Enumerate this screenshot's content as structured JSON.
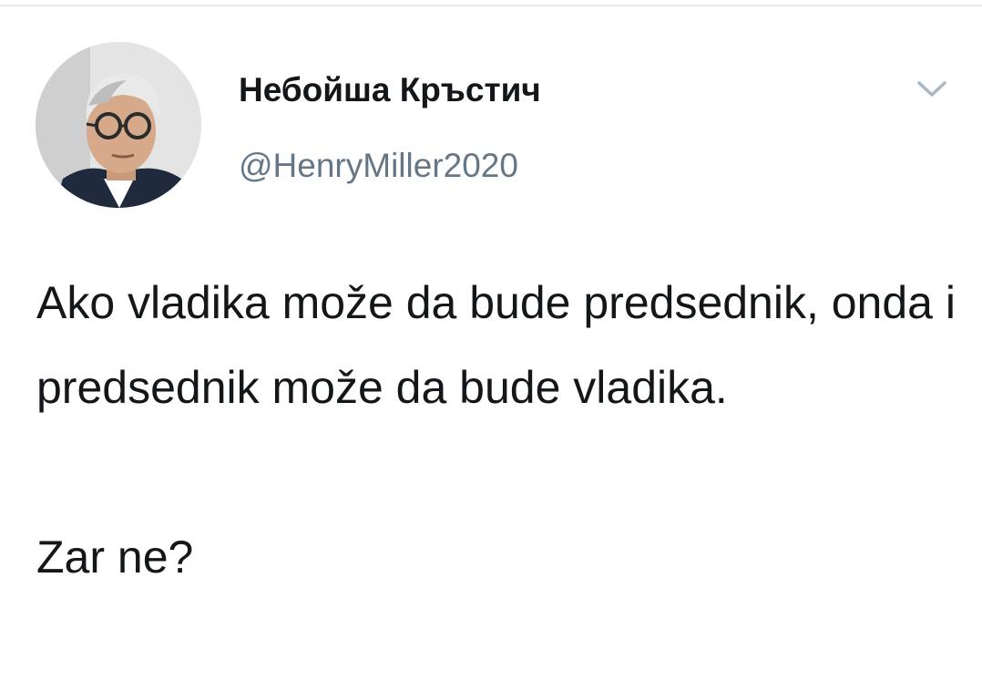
{
  "author": {
    "display_name": "Небойша Кръстич",
    "handle": "@HenryMiller2020",
    "avatar_icon": "profile-photo"
  },
  "tweet": {
    "text": "Ako vladika može da bude predsednik, onda i predsednik može da bude vladika.\n\nZar ne?"
  },
  "menu": {
    "icon": "chevron-down-icon"
  },
  "colors": {
    "name": "#14171a",
    "handle": "#657786",
    "caret": "#aab8c2",
    "divider": "#e6ecf0"
  }
}
